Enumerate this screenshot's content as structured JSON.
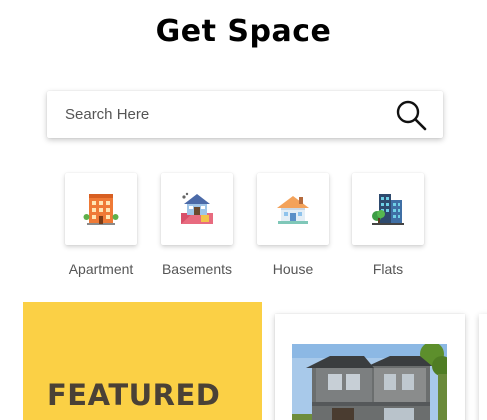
{
  "header": {
    "title": "Get Space"
  },
  "search": {
    "placeholder": "Search Here",
    "icon": "search-icon"
  },
  "categories": [
    {
      "label": "Apartment",
      "icon": "apartment-icon"
    },
    {
      "label": "Basements",
      "icon": "basement-icon"
    },
    {
      "label": "House",
      "icon": "house-icon"
    },
    {
      "label": "Flats",
      "icon": "flats-icon"
    }
  ],
  "featured": {
    "label": "FEATURED",
    "color": "#fbd045"
  },
  "listings": [
    {
      "image": "house-photo"
    }
  ]
}
